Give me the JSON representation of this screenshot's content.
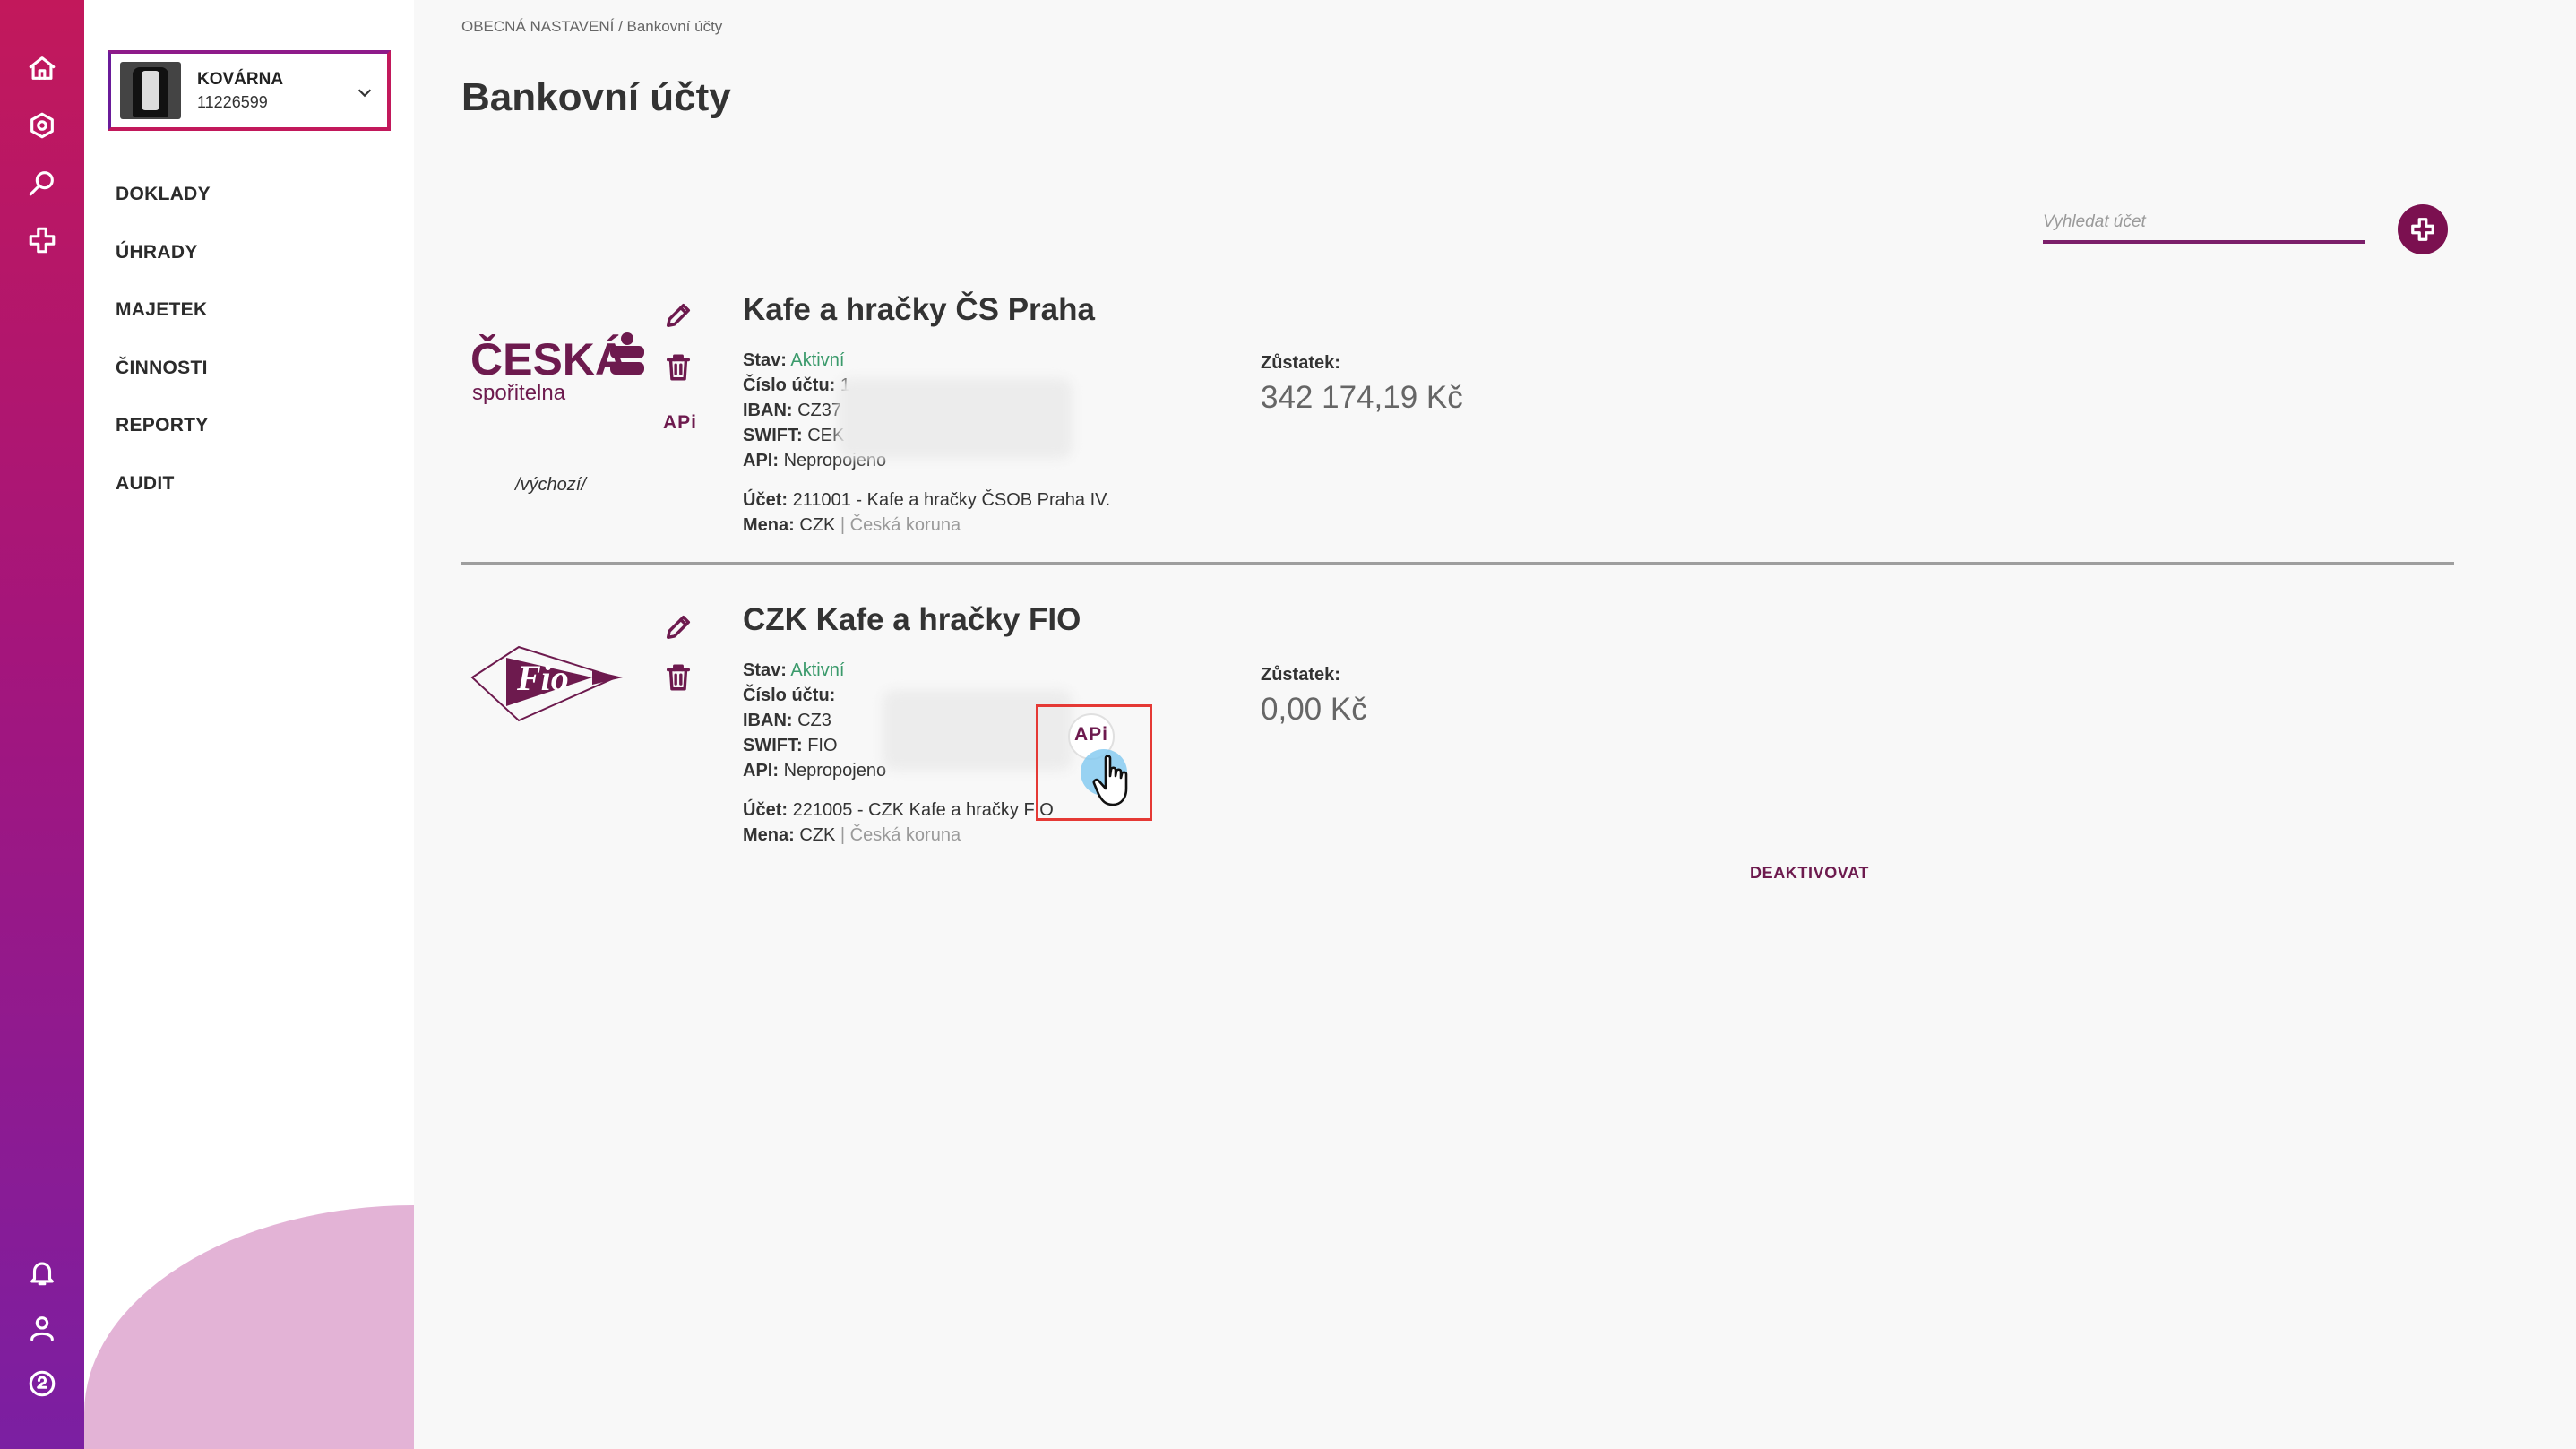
{
  "rail": {
    "top_icons": [
      "home-icon",
      "settings-hex-icon",
      "search-key-icon",
      "add-plus-icon"
    ],
    "bottom_icons": [
      "bell-icon",
      "user-icon",
      "help-icon"
    ]
  },
  "company": {
    "name": "KOVÁRNA",
    "id": "11226599"
  },
  "nav": {
    "items": [
      "DOKLADY",
      "ÚHRADY",
      "MAJETEK",
      "ČINNOSTI",
      "REPORTY",
      "AUDIT"
    ]
  },
  "breadcrumb": "OBECNÁ NASTAVENÍ / Bankovní účty",
  "page_title": "Bankovní účty",
  "search": {
    "placeholder": "Vyhledat účet"
  },
  "labels": {
    "stav": "Stav:",
    "cislo": "Číslo účtu:",
    "iban": "IBAN:",
    "swift": "SWIFT:",
    "api": "API:",
    "ucet": "Účet:",
    "mena": "Mena:",
    "zustatek": "Zůstatek:",
    "api_button": "APi",
    "separator": " | "
  },
  "accounts": [
    {
      "bank_logo": {
        "line1": "ČESKÁ",
        "line2": "spořitelna"
      },
      "default_label": "/výchozí/",
      "title": "Kafe a hračky ČS Praha",
      "status": "Aktivní",
      "account_number": "1",
      "iban": "CZ37",
      "swift": "CEK",
      "api": "Nepropojeno",
      "ledger": "211001 - Kafe a hračky ČSOB Praha IV.",
      "currency_code": "CZK",
      "currency_name": "Česká koruna",
      "balance": "342 174,19 Kč"
    },
    {
      "bank_logo": {
        "line1": "Fio"
      },
      "title": "CZK Kafe a hračky FIO",
      "status": "Aktivní",
      "account_number": "",
      "iban": "CZ3",
      "swift": "FIO",
      "api": "Nepropojeno",
      "ledger": "221005 - CZK Kafe a hračky FIO",
      "currency_code": "CZK",
      "currency_name": "Česká koruna",
      "balance": "0,00 Kč",
      "action": "DEAKTIVOVAT"
    }
  ],
  "colors": {
    "accent": "#7b1050",
    "active_status": "#3a9a6b",
    "rail_top": "#c2185b",
    "rail_bottom": "#7b1fa2"
  }
}
